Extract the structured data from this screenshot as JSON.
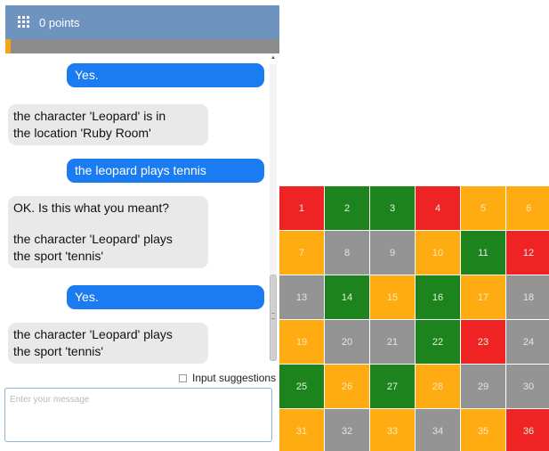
{
  "header": {
    "points_label": "0 points",
    "menu_icon": "grid-menu-icon"
  },
  "progress": {
    "fraction": 0.02,
    "fill_color": "#f2a51a",
    "track_color": "#8c8c8c"
  },
  "messages": [
    {
      "from": "user",
      "lines": [
        "Yes."
      ]
    },
    {
      "from": "bot",
      "lines": [
        "the character 'Leopard' is in",
        "the location 'Ruby Room'"
      ]
    },
    {
      "from": "user",
      "lines": [
        "the leopard plays tennis"
      ]
    },
    {
      "from": "bot",
      "lines": [
        "OK. Is this what you meant?",
        "",
        "the character 'Leopard' plays",
        "the sport 'tennis'"
      ]
    },
    {
      "from": "user",
      "lines": [
        "Yes."
      ]
    },
    {
      "from": "bot",
      "lines": [
        "the character 'Leopard' plays",
        "the sport 'tennis'"
      ]
    }
  ],
  "suggestions": {
    "label": "Input suggestions",
    "checked": false
  },
  "input": {
    "placeholder": "Enter your message",
    "value": ""
  },
  "colors": {
    "red": "#ee1111",
    "green": "#0a7a0a",
    "orange": "#ffa500",
    "gray": "#8c8c8c",
    "user_bubble": "#1a7cf0",
    "bot_bubble": "#e9e9e9",
    "header": "#6f93bf"
  },
  "grid_cells": [
    {
      "n": "1",
      "color": "red"
    },
    {
      "n": "2",
      "color": "green"
    },
    {
      "n": "3",
      "color": "green"
    },
    {
      "n": "4",
      "color": "red"
    },
    {
      "n": "5",
      "color": "orange"
    },
    {
      "n": "6",
      "color": "orange"
    },
    {
      "n": "7",
      "color": "orange"
    },
    {
      "n": "8",
      "color": "gray"
    },
    {
      "n": "9",
      "color": "gray"
    },
    {
      "n": "10",
      "color": "orange"
    },
    {
      "n": "11",
      "color": "green"
    },
    {
      "n": "12",
      "color": "red"
    },
    {
      "n": "13",
      "color": "gray"
    },
    {
      "n": "14",
      "color": "green"
    },
    {
      "n": "15",
      "color": "orange"
    },
    {
      "n": "16",
      "color": "green"
    },
    {
      "n": "17",
      "color": "orange"
    },
    {
      "n": "18",
      "color": "gray"
    },
    {
      "n": "19",
      "color": "orange"
    },
    {
      "n": "20",
      "color": "gray"
    },
    {
      "n": "21",
      "color": "gray"
    },
    {
      "n": "22",
      "color": "green"
    },
    {
      "n": "23",
      "color": "red"
    },
    {
      "n": "24",
      "color": "gray"
    },
    {
      "n": "25",
      "color": "green"
    },
    {
      "n": "26",
      "color": "orange"
    },
    {
      "n": "27",
      "color": "green"
    },
    {
      "n": "28",
      "color": "orange"
    },
    {
      "n": "29",
      "color": "gray"
    },
    {
      "n": "30",
      "color": "gray"
    },
    {
      "n": "31",
      "color": "orange"
    },
    {
      "n": "32",
      "color": "gray"
    },
    {
      "n": "33",
      "color": "orange"
    },
    {
      "n": "34",
      "color": "gray"
    },
    {
      "n": "35",
      "color": "orange"
    },
    {
      "n": "36",
      "color": "red"
    }
  ]
}
